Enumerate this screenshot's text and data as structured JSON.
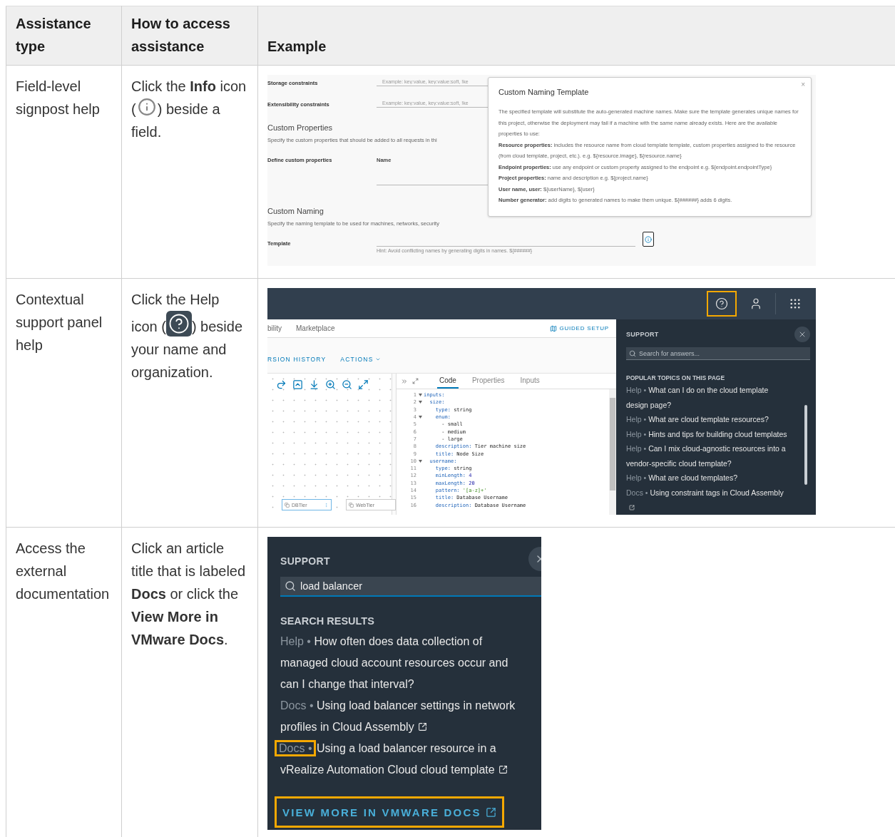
{
  "table": {
    "columns": [
      "Assistance type",
      "How to access assistance",
      "Example"
    ],
    "rows": [
      {
        "type": "Field-level signpost help",
        "access": [
          "Click the **Info** icon (",
          ") beside a field."
        ],
        "kind": "info",
        "example": {
          "kind": "signpost",
          "form": [
            {
              "kind": "field",
              "label": "Storage constraints",
              "placeholder": "Example: key:value, key:value:soft, !ke"
            },
            {
              "kind": "field",
              "label": "Extensibility constraints",
              "placeholder": "Example: key:value, key:value:soft, !ke"
            },
            {
              "kind": "section",
              "title": "Custom Properties",
              "description": "Specify the custom properties that should be added to all requests in thi"
            },
            {
              "kind": "grid",
              "label": "Define custom properties",
              "column": "Name"
            },
            {
              "kind": "section",
              "title": "Custom Naming",
              "description": "Specify the naming template to be used for machines, networks, security"
            },
            {
              "kind": "template",
              "label": "Template",
              "hint": "Hint: Avoid conflicting names by generating digits in names. ${######}"
            }
          ],
          "popover": {
            "title": "Custom Naming Template",
            "close": "×",
            "paragraphs": [
              "The specified template will substitute the auto-generated machine names. Make sure the template generates unique names for this project, otherwise the deployment may fail if a machine with the same name already exists. Here are the available properties to use:",
              "**Resource properties:** includes the resource name from cloud template template, custom properties assigned to the resource (from cloud template, project, etc.). e.g. ${resource.image}, ${resource.name}",
              "**Endpoint properties:** use any endpoint or custom property assigned to the endpoint e.g. ${endpoint.endpointType}",
              "**Project properties:** name and description e.g. ${project.name}",
              "**User name, user:** ${userName}, ${user}",
              "**Number generator:** add digits to generated names to make them unique. ${######} adds 6 digits."
            ]
          }
        }
      },
      {
        "type": "Contextual support panel help",
        "access": [
          "Click the Help icon (",
          ") beside your name and organization."
        ],
        "kind": "help",
        "example": {
          "kind": "support-panel",
          "header_icons": [
            {
              "kind": "help",
              "highlighted": true
            },
            {
              "kind": "user",
              "highlighted": false
            },
            {
              "kind": "apps",
              "highlighted": false
            }
          ],
          "nav": [
            "bility",
            "Marketplace"
          ],
          "guided_setup": "GUIDED SETUP",
          "actions": [
            "RSION HISTORY",
            "ACTIONS"
          ],
          "nodes": [
            {
              "label": "DBTier",
              "selected": true
            },
            {
              "label": "WebTier",
              "selected": false
            }
          ],
          "tabs": [
            {
              "label": "Code",
              "selected": true
            },
            {
              "label": "Properties",
              "selected": false
            },
            {
              "label": "Inputs",
              "selected": false
            }
          ],
          "code": [
            {
              "number": "1",
              "key": "inputs:",
              "fold": true
            },
            {
              "number": "2",
              "key": "  size:",
              "fold": true
            },
            {
              "number": "3",
              "key": "    type:",
              "value": " string",
              "kind": "plain",
              "fold": false
            },
            {
              "number": "4",
              "key": "    enum:",
              "fold": true
            },
            {
              "number": "5",
              "value": "      - small",
              "kind": "plain",
              "fold": false
            },
            {
              "number": "6",
              "value": "      - medium",
              "kind": "plain",
              "fold": false
            },
            {
              "number": "7",
              "value": "      - large",
              "kind": "plain",
              "fold": false
            },
            {
              "number": "8",
              "key": "    description:",
              "value": " Tier machine size",
              "kind": "plain",
              "fold": false
            },
            {
              "number": "9",
              "key": "    title:",
              "value": " Node Size",
              "kind": "plain",
              "fold": false
            },
            {
              "number": "10",
              "key": "  username:",
              "fold": true
            },
            {
              "number": "11",
              "key": "    type:",
              "value": " string",
              "kind": "plain",
              "fold": false
            },
            {
              "number": "12",
              "key": "    minLength:",
              "value": " 4",
              "kind": "number",
              "fold": false
            },
            {
              "number": "13",
              "key": "    maxLength:",
              "value": " 20",
              "kind": "number",
              "fold": false
            },
            {
              "number": "14",
              "key": "    pattern:",
              "value": " '[a-z]+'",
              "kind": "quoted",
              "fold": false
            },
            {
              "number": "15",
              "key": "    title:",
              "value": " Database Username",
              "kind": "plain",
              "fold": false
            },
            {
              "number": "16",
              "key": "    description:",
              "value": " Database Username",
              "kind": "plain",
              "fold": false
            }
          ],
          "panel": {
            "title": "SUPPORT",
            "search_placeholder": "Search for answers...",
            "heading": "POPULAR TOPICS ON THIS PAGE",
            "topics": [
              {
                "source": "Help •",
                "title": "What can I do on the cloud template design page?",
                "external": false
              },
              {
                "source": "Help •",
                "title": "What are cloud template resources?",
                "external": false
              },
              {
                "source": "Help •",
                "title": "Hints and tips for building cloud templates",
                "external": false
              },
              {
                "source": "Help •",
                "title": "Can I mix cloud-agnostic resources into a vendor-specific cloud template?",
                "external": false
              },
              {
                "source": "Help •",
                "title": "What are cloud templates?",
                "external": false
              },
              {
                "source": "Docs •",
                "title": "Using constraint tags in Cloud Assembly",
                "external": true
              }
            ]
          }
        }
      },
      {
        "type": "Access the external documentation",
        "access": [
          "Click an article title that is labeled **Docs** or click the **View More in VMware Docs**."
        ],
        "kind": "plain",
        "example": {
          "kind": "search-panel",
          "title": "SUPPORT",
          "search_value": "load balancer",
          "heading": "SEARCH RESULTS",
          "results": [
            {
              "source": "Help •",
              "title": "How often does data collection of managed cloud account resources occur and can I change that interval?",
              "external": false,
              "highlighted": false
            },
            {
              "source": "Docs •",
              "title": "Using load balancer settings in network profiles in Cloud Assembly",
              "external": true,
              "highlighted": false
            },
            {
              "source": "Docs •",
              "title": "Using a load balancer resource in a vRealize Automation Cloud cloud template",
              "external": true,
              "highlighted": true
            }
          ],
          "more_link": {
            "label": "VIEW MORE IN VMWARE DOCS",
            "highlighted": true
          }
        }
      }
    ]
  }
}
